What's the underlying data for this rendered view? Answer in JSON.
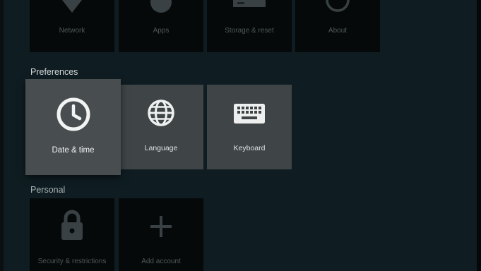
{
  "device": {
    "items": [
      {
        "label": "Network",
        "icon": "network-icon"
      },
      {
        "label": "Apps",
        "icon": "apps-icon"
      },
      {
        "label": "Storage & reset",
        "icon": "storage-icon"
      },
      {
        "label": "About",
        "icon": "about-icon"
      }
    ]
  },
  "preferences": {
    "title": "Preferences",
    "items": [
      {
        "label": "Date & time",
        "icon": "clock-icon",
        "focused": true
      },
      {
        "label": "Language",
        "icon": "globe-icon"
      },
      {
        "label": "Keyboard",
        "icon": "keyboard-icon"
      }
    ]
  },
  "personal": {
    "title": "Personal",
    "items": [
      {
        "label": "Security & restrictions",
        "icon": "lock-icon"
      },
      {
        "label": "Add account",
        "icon": "plus-icon"
      }
    ]
  },
  "colors": {
    "background": "#0f1d22",
    "tile_dark": "#050909",
    "tile_pref": "#3f4547",
    "tile_focus": "#484e50"
  }
}
